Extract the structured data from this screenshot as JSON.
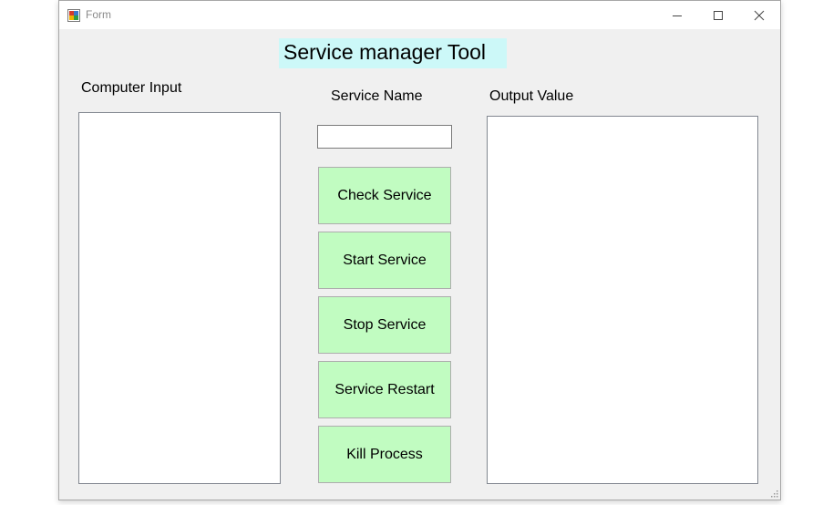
{
  "window": {
    "title": "Form",
    "controls": {
      "minimize": "minimize-icon",
      "maximize": "maximize-icon",
      "close": "close-icon"
    }
  },
  "form": {
    "heading": "Service manager Tool",
    "computer_input_label": "Computer Input",
    "service_name_label": "Service Name",
    "output_value_label": "Output Value",
    "service_name_value": "",
    "buttons": {
      "check": "Check Service",
      "start": "Start Service",
      "stop": "Stop Service",
      "restart": "Service Restart",
      "kill": "Kill Process"
    }
  },
  "colors": {
    "button_bg": "#c1fcc1",
    "heading_bg": "#ccf8f8",
    "form_bg": "#f0f0f0"
  }
}
